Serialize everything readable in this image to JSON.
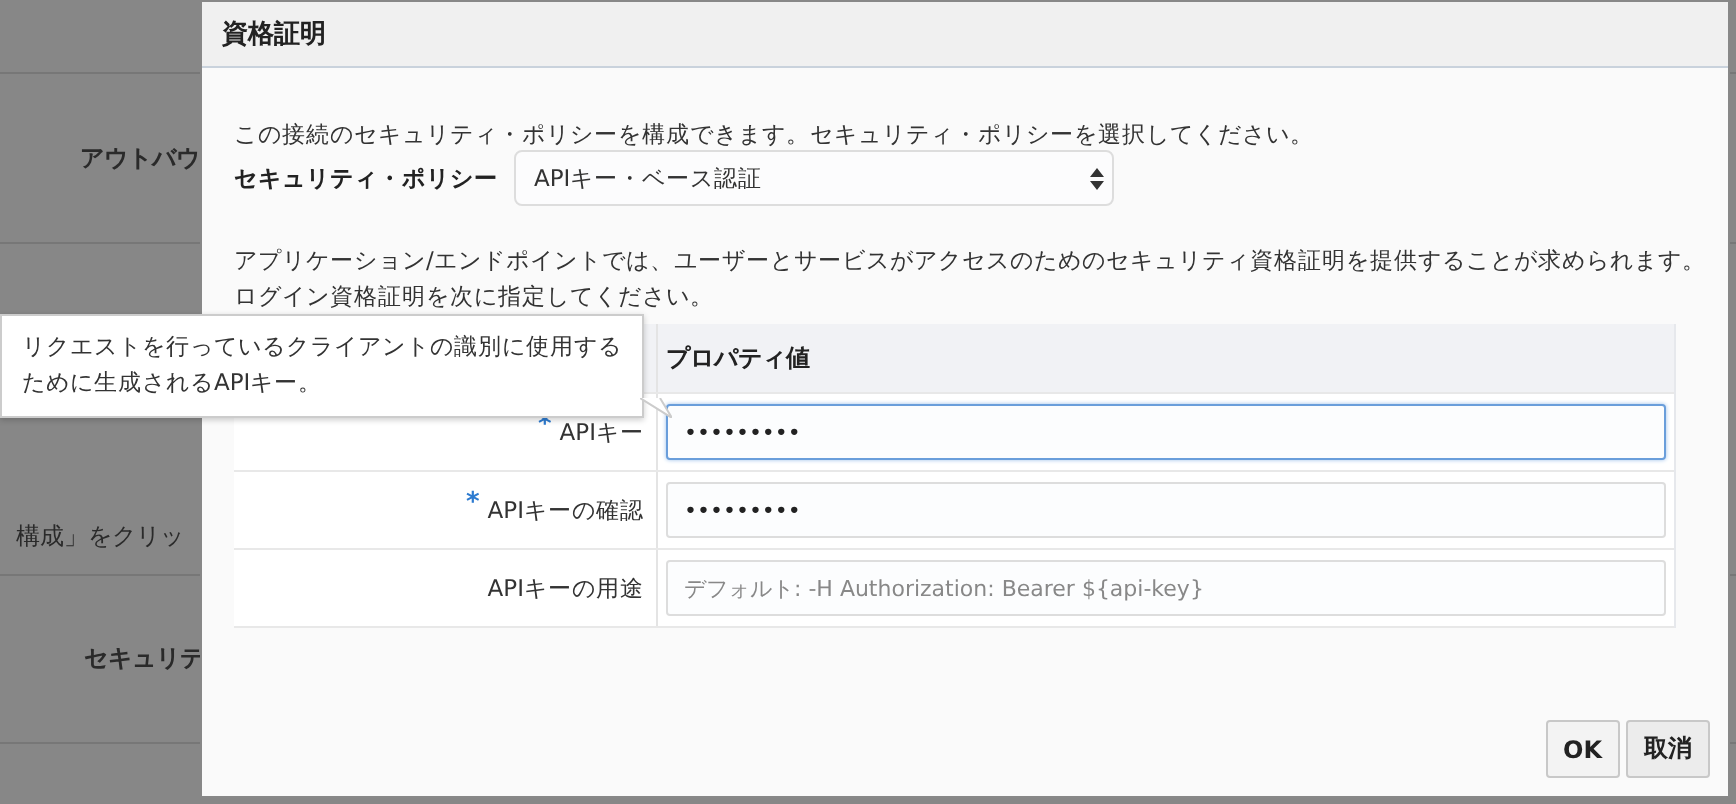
{
  "background": {
    "labels": [
      {
        "text": "アウトバウ"
      },
      {
        "text": "構成」をクリッ"
      },
      {
        "text": "セキュリテ"
      }
    ]
  },
  "dialog": {
    "title": "資格証明",
    "intro": "この接続のセキュリティ・ポリシーを構成できます。セキュリティ・ポリシーを選択してください。",
    "policy": {
      "label": "セキュリティ・ポリシー",
      "value": "APIキー・ベース認証"
    },
    "description": "アプリケーション/エンドポイントでは、ユーザーとサービスがアクセスのためのセキュリティ資格証明を提供することが求められます。ログイン資格証明を次に指定してください。",
    "table": {
      "columns": [
        "プロパティ値"
      ],
      "rows": [
        {
          "label": "APIキー",
          "required_mark": "*",
          "value": "•••••••••",
          "focused": true
        },
        {
          "label": "APIキーの確認",
          "required_mark": "*",
          "value": "•••••••••",
          "focused": false
        },
        {
          "label": "APIキーの用途",
          "placeholder": "デフォルト: -H Authorization: Bearer ${api-key}",
          "focused": false
        }
      ]
    },
    "tooltip": "リクエストを行っているクライアントの識別に使用するために生成されるAPIキー。",
    "buttons": [
      {
        "label": "OK",
        "kind": "primary"
      },
      {
        "label": "取消",
        "kind": "secondary"
      }
    ]
  }
}
